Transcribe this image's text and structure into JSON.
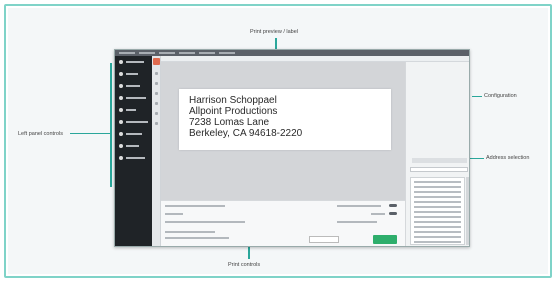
{
  "callouts": {
    "top": "Print preview / label",
    "left": "Left panel controls",
    "right_top": "Configuration",
    "right_mid": "Address selection",
    "bottom": "Print controls"
  },
  "label": {
    "line1": "Harrison Schoppael",
    "line2": "Allpoint Productions",
    "line3": "7238 Lomas Lane",
    "line4": "Berkeley, CA 94618-2220"
  },
  "colors": {
    "accent": "#2aa79b",
    "sidebar": "#1f2327",
    "print_button": "#2eae6c",
    "red_tool": "#e06a4f"
  }
}
